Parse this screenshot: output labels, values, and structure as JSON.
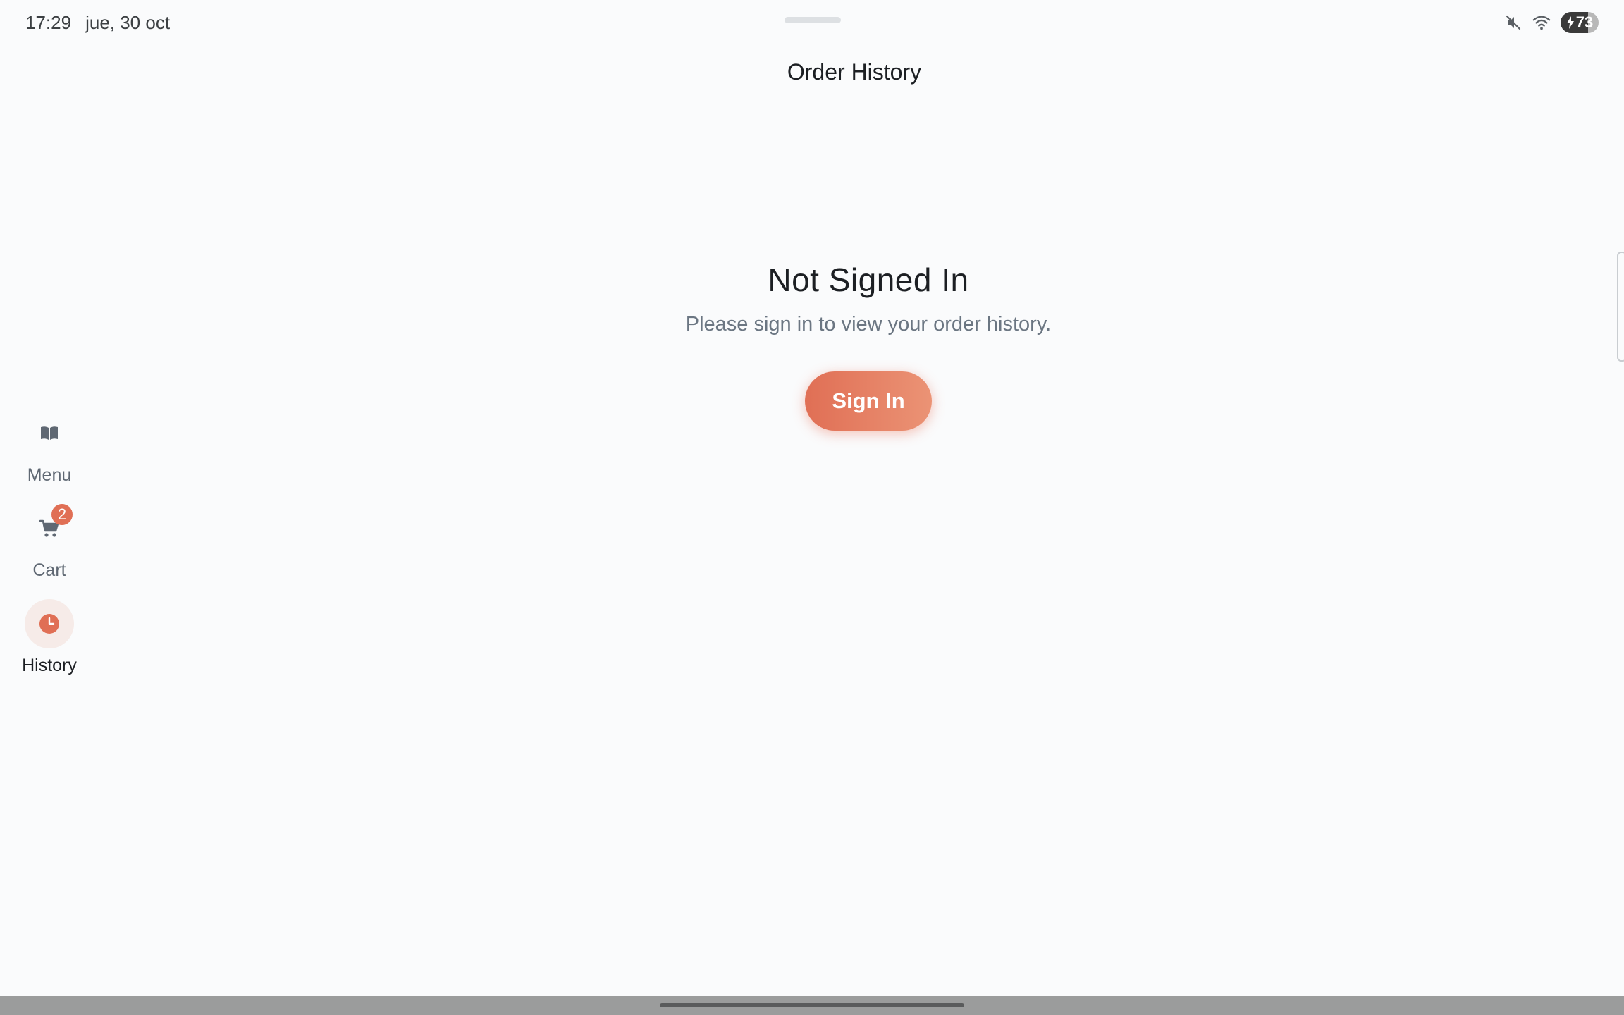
{
  "status_bar": {
    "time": "17:29",
    "date": "jue, 30 oct",
    "battery_level": "73",
    "icons": [
      "mute-icon",
      "wifi-icon",
      "battery-charging-icon"
    ]
  },
  "header": {
    "title": "Order History"
  },
  "main": {
    "title": "Not Signed In",
    "message": "Please sign in to view your order history.",
    "sign_in_label": "Sign In"
  },
  "nav": {
    "items": [
      {
        "label": "Menu",
        "icon": "book-icon",
        "active": false
      },
      {
        "label": "Cart",
        "icon": "cart-icon",
        "active": false,
        "badge": "2"
      },
      {
        "label": "History",
        "icon": "clock-icon",
        "active": true
      }
    ]
  },
  "colors": {
    "accent": "#e06f55",
    "accent_light": "#eb9375",
    "background": "#fafbfc",
    "text_primary": "#1c1f23",
    "text_secondary": "#6b7682",
    "active_nav_bg": "#f6ebe8"
  }
}
